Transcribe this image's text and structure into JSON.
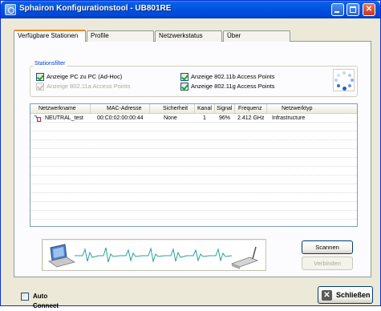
{
  "window": {
    "title": "Sphairon Konfigurationstool - UB801RE"
  },
  "tabs": [
    {
      "label": "Verfügbare Stationen",
      "active": true
    },
    {
      "label": "Profile",
      "active": false
    },
    {
      "label": "Netzwerkstatus",
      "active": false
    },
    {
      "label": "Über",
      "active": false
    }
  ],
  "station_filter": {
    "title": "Stationsfilter",
    "options": [
      {
        "label": "Anzeige PC zu PC (Ad-Hoc)",
        "checked": true,
        "enabled": true
      },
      {
        "label": "Anzeige 802.11a Access Points",
        "checked": true,
        "enabled": false
      },
      {
        "label": "Anzeige 802.11b Access Points",
        "checked": true,
        "enabled": true
      },
      {
        "label": "Anzeige 802.11g Access Points",
        "checked": true,
        "enabled": true
      }
    ]
  },
  "network_list": {
    "columns": [
      "Netzwerkname",
      "MAC-Adresse",
      "Sicherheit",
      "Kanal",
      "Signal",
      "Frequenz",
      "Netzwerktyp"
    ],
    "rows": [
      {
        "name": "NEUTRAL_test",
        "mac": "00:C0:02:00:00:44",
        "security": "None",
        "channel": "1",
        "signal": "96%",
        "frequency": "2.412 GHz",
        "type": "Infrastructure"
      }
    ]
  },
  "buttons": {
    "scan": "Scannen",
    "connect": "Verbinden",
    "close": "Schließen"
  },
  "auto_connect": {
    "label": "Auto Connect",
    "checked": false
  },
  "colors": {
    "titlebar": "#0055e5",
    "accent_tab": "#e68b2c",
    "group_title": "#0046d5",
    "check": "#21a121",
    "signal_wave": "#2aa198"
  },
  "icons": [
    "app-icon",
    "minimize-icon",
    "maximize-icon",
    "close-icon",
    "loading-spinner-icon",
    "wifi-network-icon",
    "laptop-icon",
    "router-icon",
    "close-x-icon"
  ]
}
